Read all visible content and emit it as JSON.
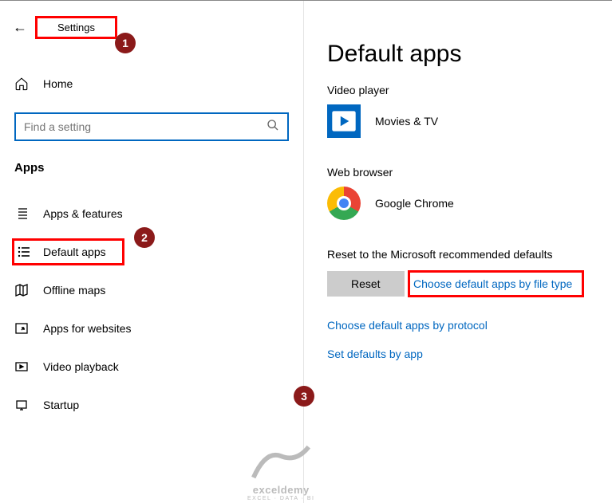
{
  "header": {
    "title": "Settings"
  },
  "sidebar": {
    "home_label": "Home",
    "search_placeholder": "Find a setting",
    "apps_heading": "Apps",
    "items": [
      {
        "label": "Apps & features"
      },
      {
        "label": "Default apps"
      },
      {
        "label": "Offline maps"
      },
      {
        "label": "Apps for websites"
      },
      {
        "label": "Video playback"
      },
      {
        "label": "Startup"
      }
    ]
  },
  "main": {
    "title": "Default apps",
    "video_section": "Video player",
    "video_app": "Movies & TV",
    "browser_section": "Web browser",
    "browser_app": "Google Chrome",
    "reset_label": "Reset to the Microsoft recommended defaults",
    "reset_button": "Reset",
    "link_filetype": "Choose default apps by file type",
    "link_protocol": "Choose default apps by protocol",
    "link_byapp": "Set defaults by app"
  },
  "callouts": {
    "c1": "1",
    "c2": "2",
    "c3": "3"
  },
  "watermark": {
    "logo": "exceldemy",
    "tag": "EXCEL · DATA · BI"
  }
}
